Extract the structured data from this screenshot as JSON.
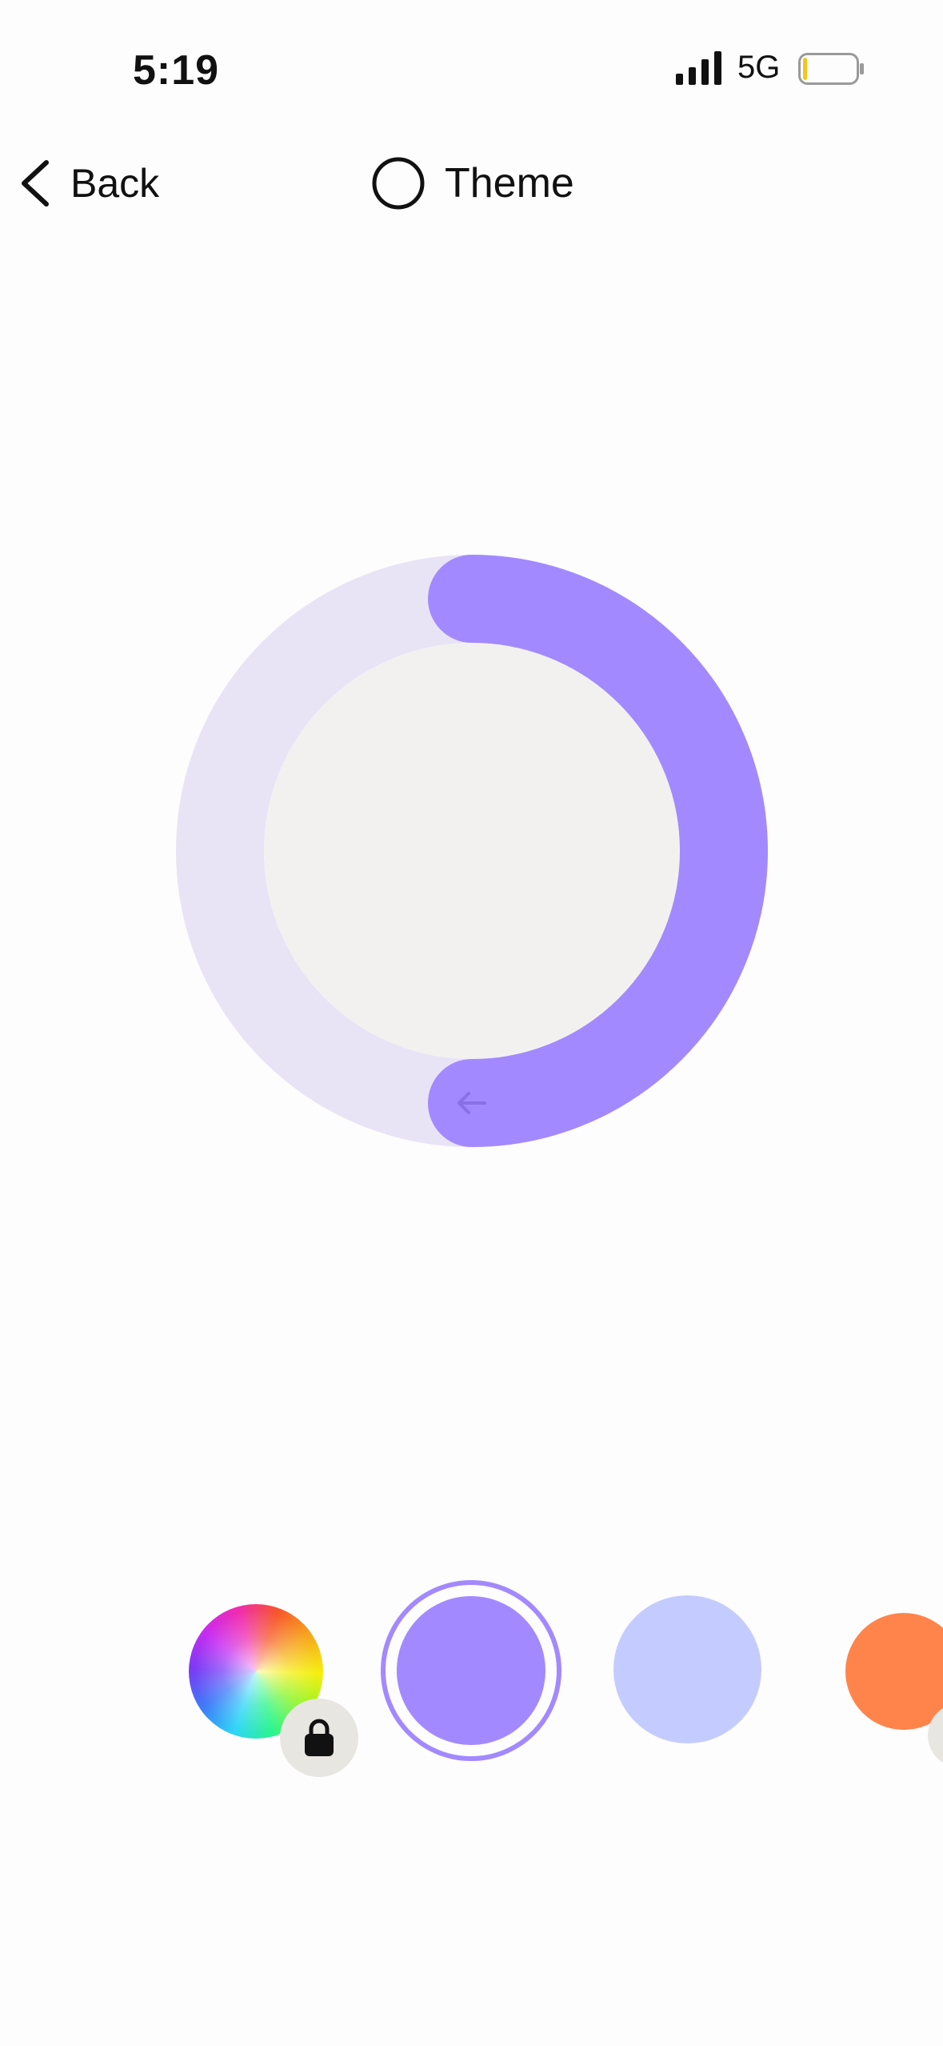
{
  "status_bar": {
    "time": "5:19",
    "network": "5G",
    "battery_level": 0.08,
    "battery_color": "#F5C518"
  },
  "nav": {
    "back_label": "Back",
    "title": "Theme",
    "back_icon": "chevron-left-icon",
    "title_icon": "circle-outline-icon"
  },
  "dial": {
    "track_color": "#E9E3F6",
    "arc_color": "#A389FF",
    "center_color": "#F2F1F0",
    "arc_progress": 0.5,
    "handle_icon": "arrow-left-icon",
    "handle_icon_color": "#8A6FE8"
  },
  "swatches": [
    {
      "name": "rainbow",
      "color": "gradient",
      "locked": true,
      "selected": false
    },
    {
      "name": "purple",
      "color": "#A389FF",
      "locked": false,
      "selected": true
    },
    {
      "name": "periwinkle",
      "color": "#C4CCFF",
      "locked": false,
      "selected": false
    },
    {
      "name": "orange",
      "color": "#FF844B",
      "locked": false,
      "selected": false
    }
  ]
}
